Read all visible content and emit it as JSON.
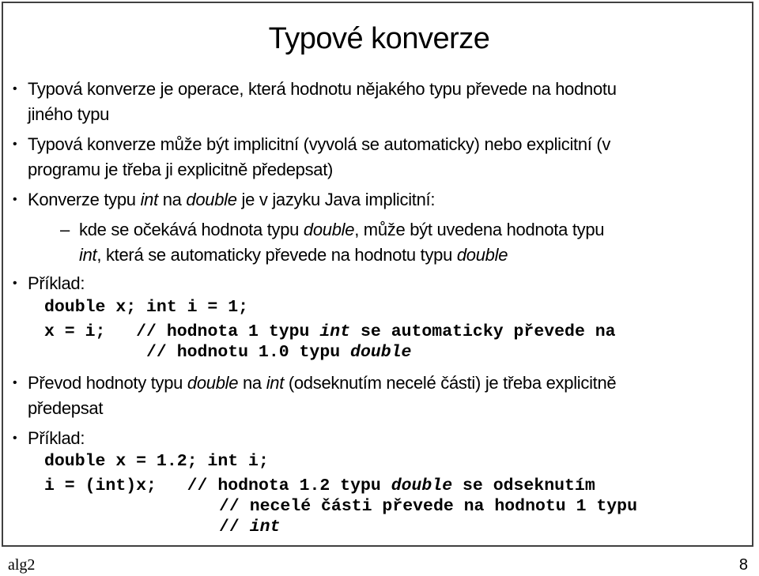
{
  "slide": {
    "title": "Typové konverze",
    "bullets": [
      {
        "lines": [
          "Typová konverze je operace, která hodnotu nějakého typu převede na hodnotu",
          "jiného typu"
        ]
      },
      {
        "lines": [
          "Typová konverze může být implicitní (vyvolá se automaticky) nebo explicitní (v",
          "programu je třeba ji explicitně předepsat)"
        ]
      },
      {
        "parts": {
          "t1": "Konverze typu ",
          "i1": "int",
          "t2": " na ",
          "i2": "double",
          "t3": " je v jazyku Java implicitní:"
        },
        "sub": {
          "dash": "–",
          "line1": {
            "t1": "kde se očekává hodnota typu ",
            "i1": "double",
            "t2": ", může být uvedena hodnota typu"
          },
          "line2": {
            "i1": "int",
            "t1": ", která se automaticky převede na hodnotu typu ",
            "i2": "double"
          }
        }
      },
      {
        "label": "Příklad:",
        "code": {
          "line1": "double x; int i = 1;",
          "line2": {
            "stmt": "x = i;   ",
            "c1": "// hodnota 1 typu ",
            "i1": "int",
            "c2": " se automaticky převede na"
          },
          "line3": {
            "c1": "// hodnotu 1.0 typu ",
            "i1": "double"
          }
        }
      },
      {
        "parts": {
          "t1": "Převod hodnoty typu ",
          "i1": "double",
          "t2": " na ",
          "i2": "int",
          "t3": " (odseknutím necelé části) je třeba explicitně"
        },
        "line2": "předepsat"
      },
      {
        "label": "Příklad:",
        "code": {
          "line1": "double x = 1.2; int i;",
          "line2": {
            "stmt": "i = (int)x;   ",
            "c1": "// hodnota 1.2 typu ",
            "i1": "double",
            "c2": " se odseknutím"
          },
          "line3": "// necelé části převede na hodnotu 1 typu",
          "line4": {
            "c1": "// ",
            "i1": "int"
          }
        }
      }
    ]
  },
  "footer": {
    "left": "alg2",
    "page_number": "8"
  }
}
